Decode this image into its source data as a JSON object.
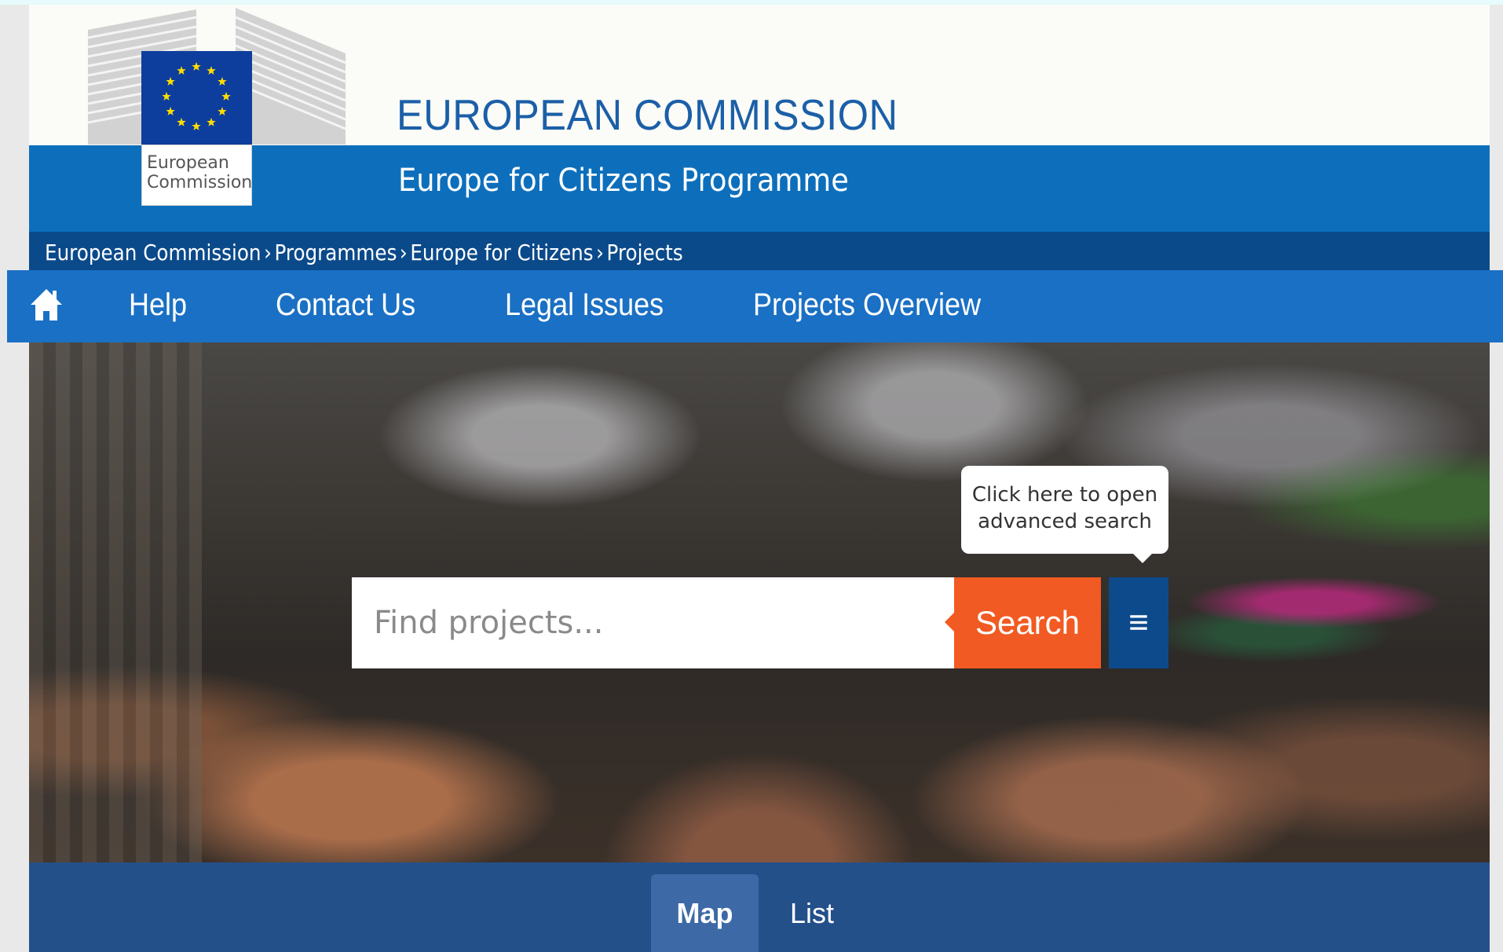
{
  "header": {
    "logo_line1": "European",
    "logo_line2": "Commission",
    "title": "EUROPEAN COMMISSION",
    "subtitle": "Europe for Citizens Programme"
  },
  "breadcrumb": [
    "European Commission",
    "Programmes",
    "Europe for Citizens",
    "Projects"
  ],
  "breadcrumb_separator": "›",
  "nav": {
    "items": [
      "Help",
      "Contact Us",
      "Legal Issues",
      "Projects Overview"
    ]
  },
  "search": {
    "placeholder": "Find projects...",
    "button_label": "Search",
    "menu_glyph": "≡",
    "tooltip": "Click here to open advanced search"
  },
  "tabs": {
    "map": "Map",
    "list": "List"
  },
  "colors": {
    "brand_blue": "#0d6fbc",
    "nav_blue": "#1a70c4",
    "breadcrumb_blue": "#0b4a8a",
    "search_orange": "#f15a22",
    "eu_flag_blue": "#0d3e9d",
    "tabs_blue": "#24508a"
  }
}
